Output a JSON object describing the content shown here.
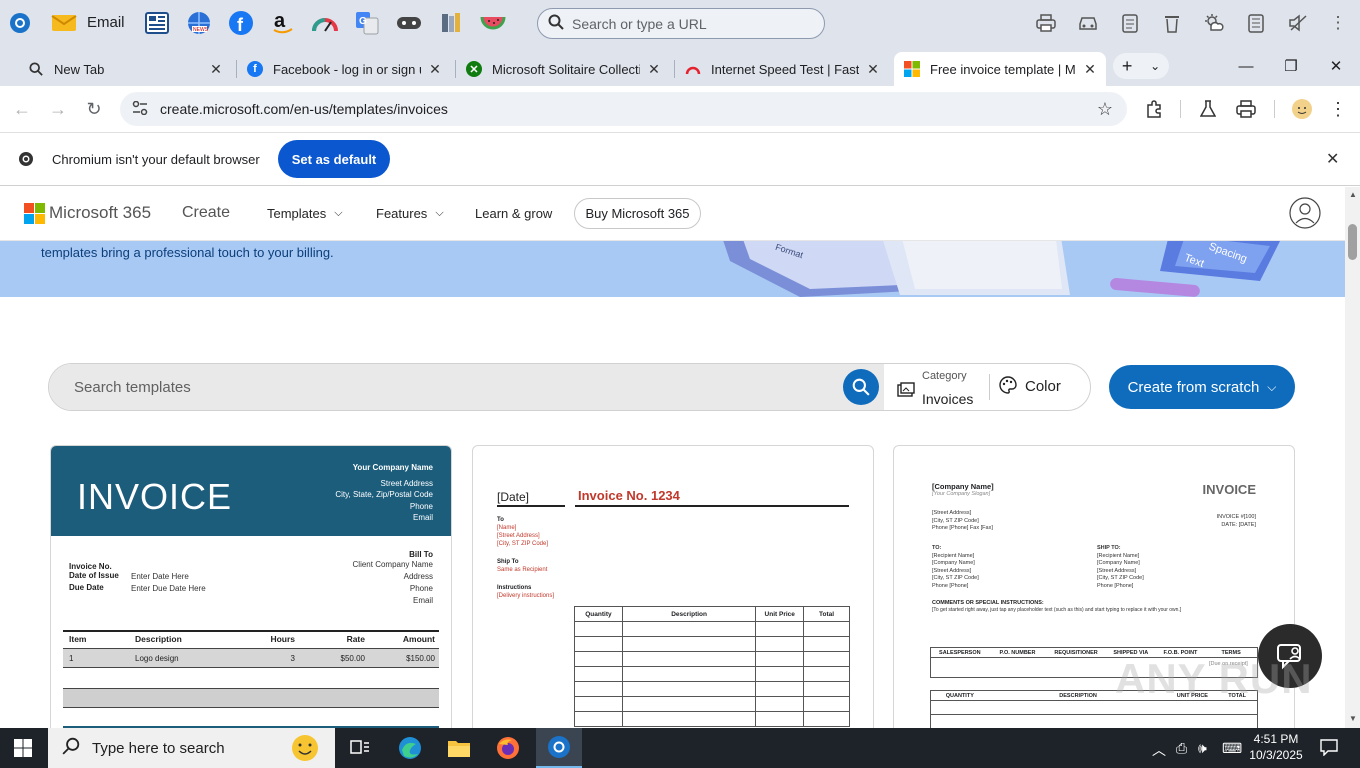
{
  "bookmarks": {
    "email_label": "Email",
    "omnibox_placeholder": "Search or type a URL"
  },
  "tabs": [
    {
      "title": "New Tab"
    },
    {
      "title": "Facebook - log in or sign up"
    },
    {
      "title": "Microsoft Solitaire Collection"
    },
    {
      "title": "Internet Speed Test | Fast.com"
    },
    {
      "title": "Free invoice template | Micr"
    }
  ],
  "toolbar": {
    "url": "create.microsoft.com/en-us/templates/invoices"
  },
  "infobar": {
    "message": "Chromium isn't your default browser",
    "button": "Set as default"
  },
  "site": {
    "brand": "Microsoft 365",
    "create": "Create",
    "nav": [
      "Templates",
      "Features",
      "Learn & grow"
    ],
    "buy": "Buy Microsoft 365",
    "hero_text": "templates bring a professional touch to your billing.",
    "hero_deco": [
      "Format",
      "Spacing",
      "Text"
    ],
    "search_placeholder": "Search templates",
    "category_label": "Category",
    "category_value": "Invoices",
    "color_label": "Color",
    "create_button": "Create from scratch"
  },
  "card1": {
    "title": "INVOICE",
    "company": "Your Company Name",
    "company_lines": [
      "Street Address",
      "City, State, Zip/Postal Code",
      "Phone",
      "Email"
    ],
    "bill_to": "Bill To",
    "bill_lines": [
      "Client Company Name",
      "Address",
      "Phone",
      "Email"
    ],
    "fields": [
      {
        "label": "Invoice No.",
        "value": ""
      },
      {
        "label": "Date of Issue",
        "value": "Enter Date Here"
      },
      {
        "label": "Due Date",
        "value": "Enter Due Date Here"
      }
    ],
    "columns": [
      "Item",
      "Description",
      "Hours",
      "Rate",
      "Amount"
    ],
    "row": [
      "1",
      "Logo design",
      "3",
      "$50.00",
      "$150.00"
    ]
  },
  "card2": {
    "date": "[Date]",
    "title": "Invoice No. 1234",
    "to_label": "To",
    "to_lines": [
      "[Name]",
      "[Street Address]",
      "[City, ST ZIP Code]"
    ],
    "ship_label": "Ship To",
    "ship_lines": [
      "Same as Recipient"
    ],
    "instr_label": "Instructions",
    "instr_lines": [
      "[Delivery instructions]"
    ],
    "columns": [
      "Quantity",
      "Description",
      "Unit Price",
      "Total"
    ]
  },
  "card3": {
    "company": "[Company Name]",
    "slogan": "[Your Company Slogan]",
    "title": "INVOICE",
    "addr_lines": [
      "[Street Address]",
      "[City, ST ZIP Code]",
      "Phone [Phone]   Fax [Fax]"
    ],
    "inv_lines": [
      "INVOICE #[100]",
      "DATE: [DATE]"
    ],
    "to_label": "TO:",
    "to_lines": [
      "[Recipient Name]",
      "[Company Name]",
      "[Street Address]",
      "[City, ST ZIP Code]",
      "Phone [Phone]"
    ],
    "ship_label": "SHIP TO:",
    "ship_lines": [
      "[Recipient Name]",
      "[Company Name]",
      "[Street Address]",
      "[City, ST ZIP Code]",
      "Phone [Phone]"
    ],
    "comments_label": "COMMENTS OR SPECIAL INSTRUCTIONS:",
    "comments_text": "[To get started right away, just tap any placeholder text (such as this) and start typing to replace it with your own.]",
    "table1": [
      "SALESPERSON",
      "P.O. NUMBER",
      "REQUISITIONER",
      "SHIPPED VIA",
      "F.O.B. POINT",
      "TERMS"
    ],
    "terms_value": "[Due on receipt]",
    "table2": [
      "QUANTITY",
      "DESCRIPTION",
      "UNIT PRICE",
      "TOTAL"
    ]
  },
  "taskbar": {
    "search_placeholder": "Type here to search",
    "time": "4:51 PM",
    "date": "10/3/2025"
  },
  "watermark": "ANY RUN"
}
